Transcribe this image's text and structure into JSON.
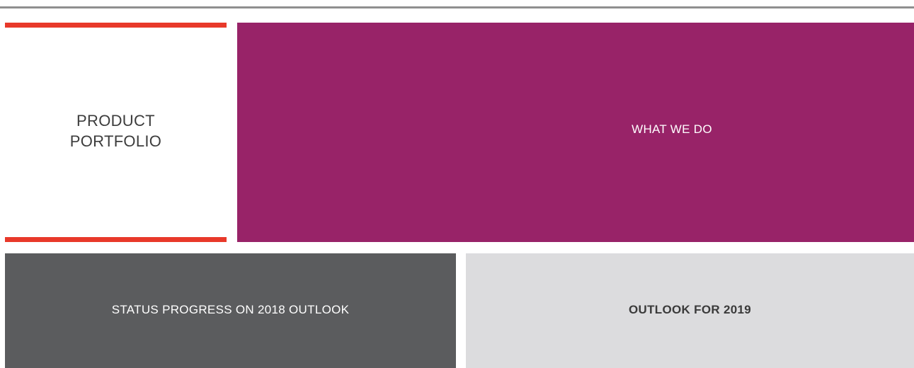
{
  "tiles": {
    "portfolio": {
      "label": "PRODUCT PORTFOLIO"
    },
    "what_we_do": {
      "label": "WHAT WE DO"
    },
    "status": {
      "label": "STATUS PROGRESS ON 2018 OUTLOOK"
    },
    "outlook": {
      "label": "OUTLOOK FOR 2019"
    }
  },
  "colors": {
    "accent_red": "#e8392a",
    "magenta": "#982368",
    "dark_gray": "#5b5c5e",
    "light_gray": "#dcdcde",
    "rule_gray": "#8f8f8f"
  }
}
